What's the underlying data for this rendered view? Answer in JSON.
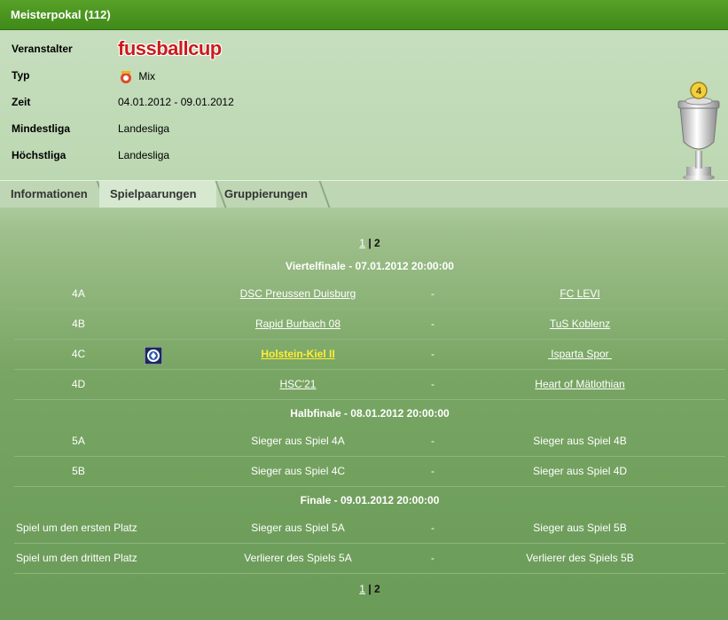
{
  "title": "Meisterpokal (112)",
  "info": [
    {
      "label": "Veranstalter",
      "value": "fussballcup"
    },
    {
      "label": "Typ",
      "value": "Mix",
      "icon": "mix-icon"
    },
    {
      "label": "Zeit",
      "value": "04.01.2012 - 09.01.2012"
    },
    {
      "label": "Mindestliga",
      "value": "Landesliga"
    },
    {
      "label": "Höchstliga",
      "value": "Landesliga"
    }
  ],
  "cup_badge": "4",
  "tabs": [
    {
      "label": "Informationen",
      "active": false
    },
    {
      "label": "Spielpaarungen",
      "active": true
    },
    {
      "label": "Gruppierungen",
      "active": false
    }
  ],
  "pager": {
    "page1": "1",
    "sep": " | ",
    "page2": "2"
  },
  "rounds": [
    {
      "header": "Viertelfinale - 07.01.2012 20:00:00",
      "matches": [
        {
          "id": "4A",
          "home": "DSC Preussen Duisburg",
          "dash": "-",
          "away": "FC LEVI"
        },
        {
          "id": "4B",
          "home": "Rapid Burbach 08",
          "dash": "-",
          "away": "TuS Koblenz"
        },
        {
          "id": "4C",
          "home": "Holstein-Kiel II",
          "dash": "-",
          "away": " Isparta Spor ",
          "home_badge": "team-crest-icon"
        },
        {
          "id": "4D",
          "home": "HSC'21",
          "dash": "-",
          "away": "Heart of Mätlothian"
        }
      ]
    },
    {
      "header": "Halbfinale - 08.01.2012 20:00:00",
      "matches": [
        {
          "id": "5A",
          "home": "Sieger aus Spiel 4A",
          "dash": "-",
          "away": "Sieger aus Spiel 4B"
        },
        {
          "id": "5B",
          "home": "Sieger aus Spiel 4C",
          "dash": "-",
          "away": "Sieger aus Spiel 4D"
        }
      ]
    },
    {
      "header": "Finale - 09.01.2012 20:00:00",
      "matches": [
        {
          "id": "Spiel um den ersten Platz",
          "home": "Sieger aus Spiel 5A",
          "dash": "-",
          "away": "Sieger aus Spiel 5B"
        },
        {
          "id": "Spiel um den dritten Platz",
          "home": "Verlierer des Spiels 5A",
          "dash": "-",
          "away": "Verlierer des Spiels 5B"
        }
      ]
    }
  ],
  "colors": {
    "titlebar": "#4a9520",
    "highlight": "#ffee33",
    "logo": "#cc1a1a"
  }
}
